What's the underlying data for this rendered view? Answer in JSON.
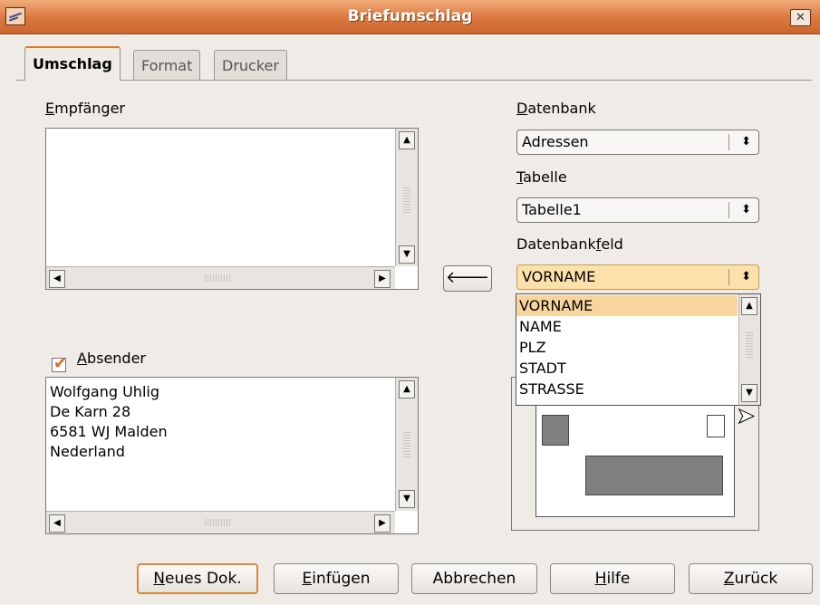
{
  "window": {
    "title": "Briefumschlag",
    "close_glyph": "✕"
  },
  "tabs": [
    {
      "label": "Umschlag",
      "active": true
    },
    {
      "label": "Format",
      "active": false
    },
    {
      "label": "Drucker",
      "active": false
    }
  ],
  "recipient": {
    "label_mn": "E",
    "label_rest": "mpfänger",
    "text": ""
  },
  "sender": {
    "checked": true,
    "label_mn": "A",
    "label_rest": "bsender",
    "lines": [
      "Wolfgang Uhlig",
      "De Karn 28",
      "6581 WJ Malden",
      "Nederland"
    ]
  },
  "database": {
    "label_mn": "D",
    "label_rest": "atenbank",
    "value": "Adressen"
  },
  "table": {
    "label_mn": "T",
    "label_rest": "abelle",
    "value": "Tabelle1"
  },
  "dbfield": {
    "label_pre": "Datenbank",
    "label_mn": "f",
    "label_rest": "eld",
    "value": "VORNAME",
    "options": [
      "VORNAME",
      "NAME",
      "PLZ",
      "STADT",
      "STRASSE"
    ],
    "selected_index": 0
  },
  "insert_arrow": "🡐",
  "buttons": {
    "new_doc": {
      "mn": "N",
      "rest": "eues Dok."
    },
    "insert": {
      "mn": "E",
      "rest": "infügen"
    },
    "cancel": {
      "label": "Abbrechen"
    },
    "help": {
      "mn": "H",
      "rest": "ilfe"
    },
    "back": {
      "mn": "Z",
      "rest": "urück"
    }
  },
  "icons": {
    "up": "▲",
    "down": "▼",
    "left": "◀",
    "right": "▶",
    "spin": "⬍",
    "check": "✔"
  },
  "colors": {
    "accent": "#e07a2a",
    "highlight": "#f8d59c",
    "title_bar": "#d9773e"
  }
}
